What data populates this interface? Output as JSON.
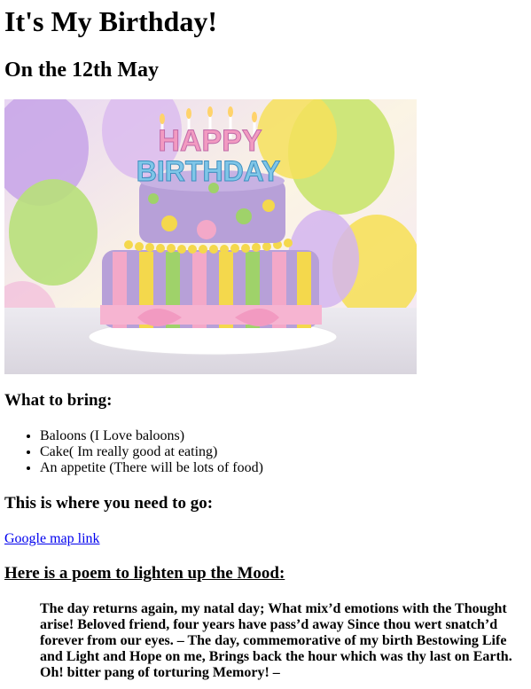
{
  "heading": "It's My Birthday!",
  "date_heading": "On the 12th May",
  "cake_image": {
    "topper_line1": "HAPPY",
    "topper_line2": "BIRTHDAY",
    "colors": {
      "cake_purple": "#b7a0d8",
      "stripe_yellow": "#f4d84c",
      "stripe_pink": "#f3a8c8",
      "stripe_green": "#9fd26a",
      "balloon_yellow": "#f6e05c",
      "balloon_green": "#b8e07a",
      "balloon_purple": "#c9a7e8"
    }
  },
  "bring_heading": "What to bring:",
  "bring_items": [
    "Baloons (I Love baloons)",
    "Cake( Im really good at eating)",
    "An appetite (There will be lots of food)"
  ],
  "where_heading": "This is where you need to go:",
  "map_link": "Google map link",
  "poem_heading": "Here is a poem to lighten up the Mood:",
  "poem": "The day returns again, my natal day; What mix’d emotions with the Thought arise! Beloved friend, four years have pass’d away Since thou wert snatch’d forever from our eyes. – The day, commemorative of my birth Bestowing Life and Light and Hope on me, Brings back the hour which was thy last on Earth. Oh! bitter pang of torturing Memory! –"
}
